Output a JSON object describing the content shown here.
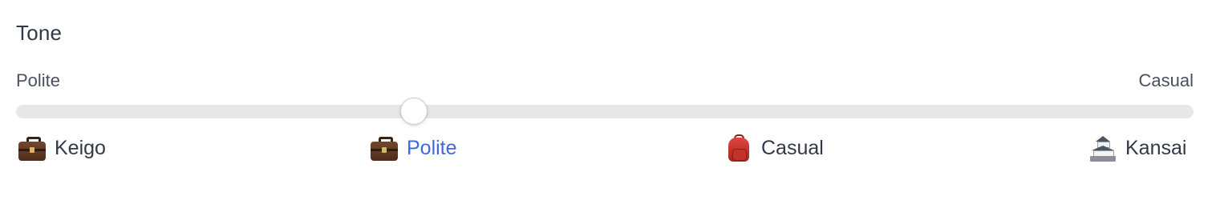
{
  "tone": {
    "title": "Tone",
    "left_label": "Polite",
    "right_label": "Casual",
    "selected_index": 1,
    "slider_value_fraction": 0.33,
    "options": [
      {
        "label": "Keigo",
        "icon": "briefcase-icon"
      },
      {
        "label": "Polite",
        "icon": "briefcase-icon"
      },
      {
        "label": "Casual",
        "icon": "backpack-icon"
      },
      {
        "label": "Kansai",
        "icon": "castle-icon"
      }
    ]
  },
  "colors": {
    "accent": "#3f68e0",
    "track": "#e7e7ea",
    "text": "#333846"
  }
}
